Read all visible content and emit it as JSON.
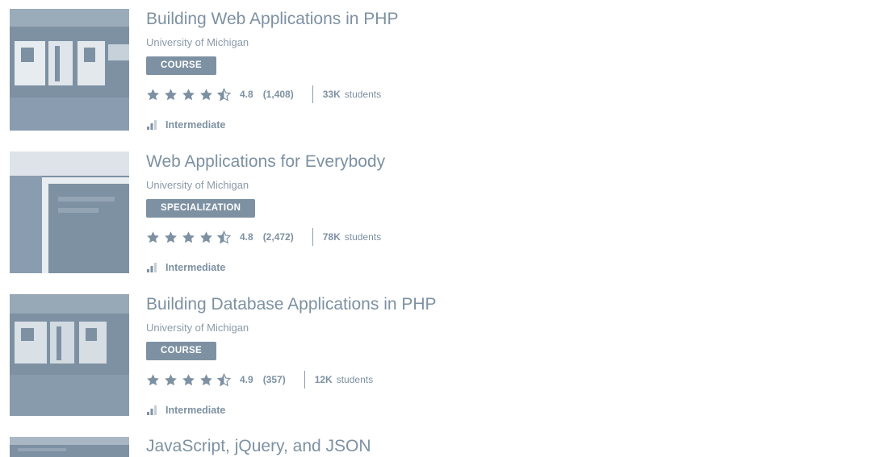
{
  "courses": [
    {
      "title": "Building Web Applications in PHP",
      "partner": "University of Michigan",
      "type": "COURSE",
      "rating": "4.8",
      "rating_count": "(1,408)",
      "enrollment": "33K",
      "enrollment_label": "students",
      "level": "Intermediate",
      "thumb_icon": "php-logo-photo"
    },
    {
      "title": "Web Applications for Everybody",
      "partner": "University of Michigan",
      "type": "SPECIALIZATION",
      "rating": "4.8",
      "rating_count": "(2,472)",
      "enrollment": "78K",
      "enrollment_label": "students",
      "level": "Intermediate",
      "thumb_icon": "monitor-photo"
    },
    {
      "title": "Building Database Applications in PHP",
      "partner": "University of Michigan",
      "type": "COURSE",
      "rating": "4.9",
      "rating_count": "(357)",
      "enrollment": "12K",
      "enrollment_label": "students",
      "level": "Intermediate",
      "thumb_icon": "php-logo-photo"
    },
    {
      "title": "JavaScript, jQuery, and JSON",
      "partner": "",
      "type": "",
      "rating": "",
      "rating_count": "",
      "enrollment": "",
      "enrollment_label": "",
      "level": "",
      "thumb_icon": "code-photo"
    }
  ],
  "colors": {
    "accent": "#7d91a3",
    "text_muted": "#8b9aaa",
    "background": "#ffffff"
  }
}
